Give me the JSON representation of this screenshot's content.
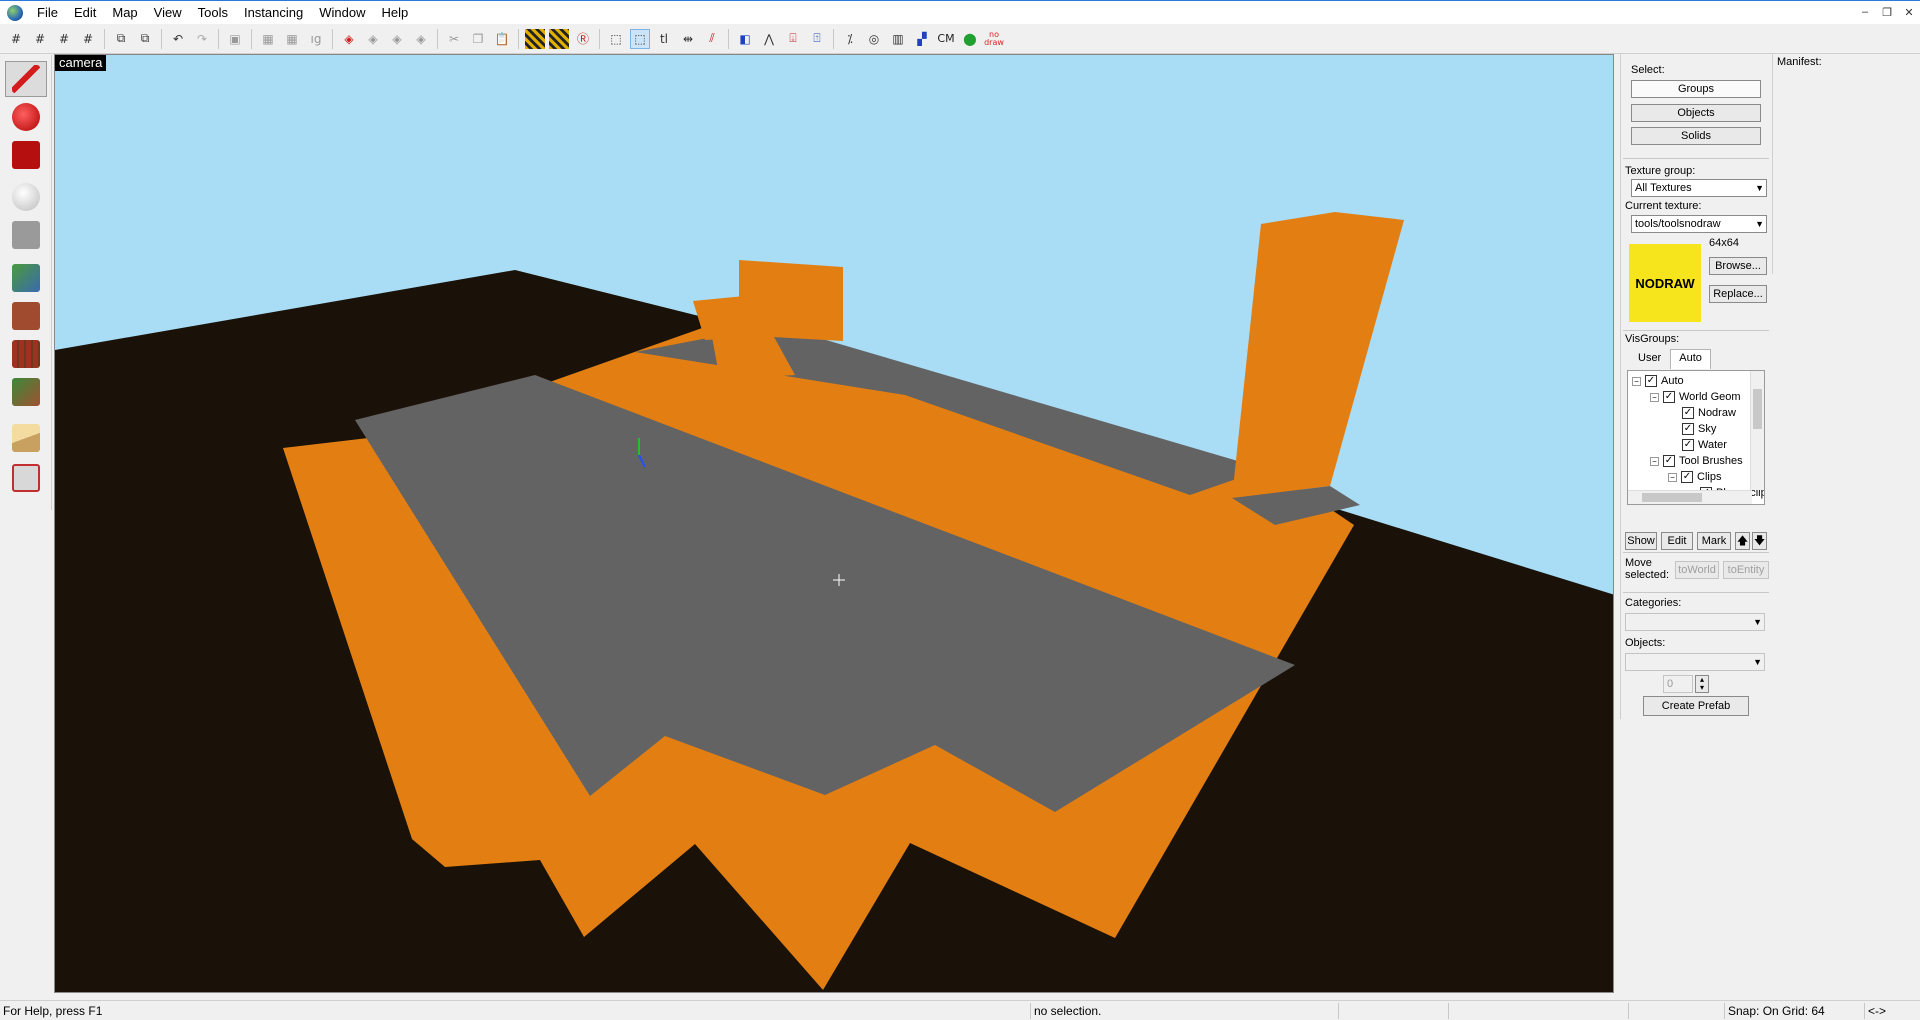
{
  "menubar": {
    "items": [
      "File",
      "Edit",
      "Map",
      "View",
      "Tools",
      "Instancing",
      "Window",
      "Help"
    ],
    "window_controls": [
      "–",
      "❐",
      "✕"
    ]
  },
  "toolbar": {
    "cm_label": "CM",
    "no_draw_label": "no draw"
  },
  "viewport": {
    "label": "camera",
    "sky_color": "#a9dcf5",
    "ground_color": "#1a1208",
    "floor_color": "#636363",
    "nodraw_color": "#e37f12"
  },
  "select": {
    "label": "Select:",
    "groups": "Groups",
    "objects": "Objects",
    "solids": "Solids"
  },
  "texture": {
    "group_label": "Texture group:",
    "group_value": "All Textures",
    "current_label": "Current texture:",
    "current_value": "tools/toolsnodraw",
    "preview_text": "NODRAW",
    "size": "64x64",
    "browse": "Browse...",
    "replace": "Replace..."
  },
  "visgroups": {
    "label": "VisGroups:",
    "tabs": [
      "User",
      "Auto"
    ],
    "tree": [
      {
        "label": "Auto",
        "expander": "⊟"
      },
      {
        "label": "World Geom",
        "expander": "⊟"
      },
      {
        "label": "Nodraw"
      },
      {
        "label": "Sky"
      },
      {
        "label": "Water"
      },
      {
        "label": "Tool Brushes",
        "expander": "⊟"
      },
      {
        "label": "Clips",
        "expander": "⊟"
      },
      {
        "label": "Player clip"
      }
    ],
    "show": "Show",
    "edit": "Edit",
    "mark": "Mark",
    "up": "🡅",
    "down": "🡇"
  },
  "move_selected": {
    "label": "Move selected:",
    "to_world": "toWorld",
    "to_entity": "toEntity"
  },
  "prefab": {
    "categories_label": "Categories:",
    "objects_label": "Objects:",
    "count": "0",
    "create": "Create Prefab"
  },
  "manifest": {
    "label": "Manifest:"
  },
  "status": {
    "help": "For Help, press F1",
    "selection": "no selection.",
    "snap": "Snap: On Grid: 64",
    "zoom": "<->"
  }
}
